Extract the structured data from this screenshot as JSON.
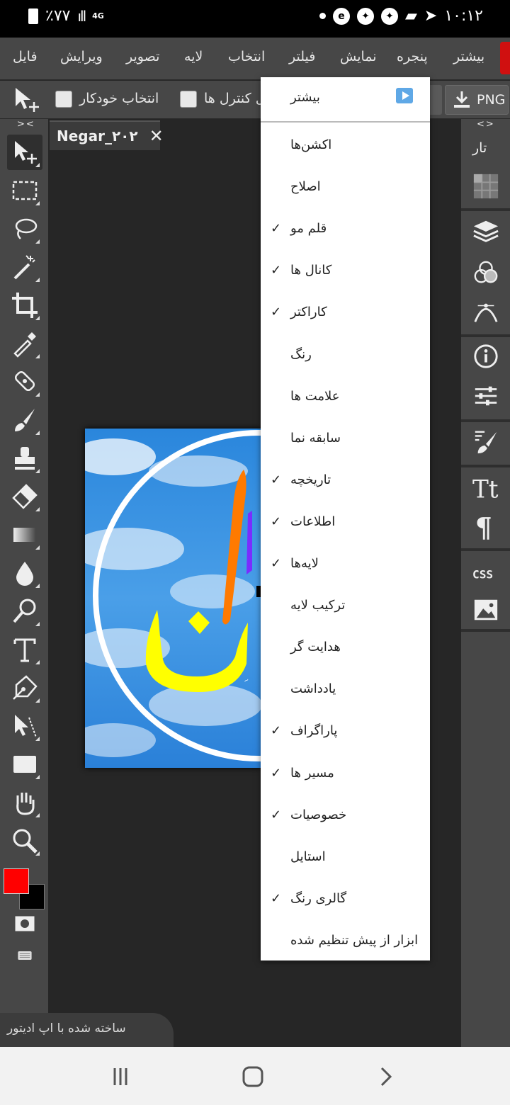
{
  "status_bar": {
    "battery": "٪۷۷",
    "network": "4G",
    "time": "۱۰:۱۲"
  },
  "menu": {
    "items": [
      "بیشتر",
      "پنجره",
      "نمایش",
      "فیلتر",
      "انتخاب",
      "لایه",
      "تصویر",
      "ویرایش",
      "فایل"
    ]
  },
  "options_bar": {
    "auto_select_label": "انتخاب خودکار",
    "transform_controls_label": "ل کنترل ها",
    "export_format": "PNG"
  },
  "document": {
    "tab_name": "Negar_۲۰۲"
  },
  "right_panel": {
    "label": "تار"
  },
  "window_menu": {
    "header_label": "بیشتر",
    "items": [
      {
        "label": "اکشن‌ها",
        "check": ""
      },
      {
        "label": "اصلاح",
        "check": ""
      },
      {
        "label": "قلم مو",
        "check": "✓"
      },
      {
        "label": "کانال ها",
        "check": "✓"
      },
      {
        "label": "کاراکتر",
        "check": "✓"
      },
      {
        "label": "رنگ",
        "check": ""
      },
      {
        "label": "علامت ها",
        "check": ""
      },
      {
        "label": "سابقه نما",
        "check": ""
      },
      {
        "label": "تاریخچه",
        "check": "✓"
      },
      {
        "label": "اطلاعات",
        "check": "✓"
      },
      {
        "label": "لایه‌ها",
        "check": "✓"
      },
      {
        "label": "ترکیب لایه",
        "check": ""
      },
      {
        "label": "هدایت گر",
        "check": ""
      },
      {
        "label": "یادداشت",
        "check": ""
      },
      {
        "label": "پاراگراف",
        "check": "✓"
      },
      {
        "label": "مسیر ها",
        "check": "✓"
      },
      {
        "label": "خصوصیات",
        "check": "✓"
      },
      {
        "label": "استایل",
        "check": ""
      },
      {
        "label": "گالری رنگ",
        "check": "✓"
      },
      {
        "label": "ابزار از پیش تنظیم شده",
        "check": ""
      }
    ]
  },
  "colors": {
    "foreground": "#ff0000",
    "background": "#000000"
  },
  "watermark": "ساخته شده با اپ ادیتور"
}
